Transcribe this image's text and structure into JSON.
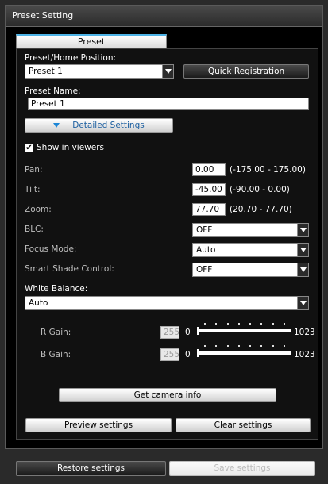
{
  "window": {
    "title": "Preset Setting"
  },
  "tab": {
    "label": "Preset"
  },
  "preset_home": {
    "label": "Preset/Home Position:",
    "selected": "Preset 1"
  },
  "quick_registration": {
    "label": "Quick Registration"
  },
  "preset_name": {
    "label": "Preset Name:",
    "value": "Preset 1"
  },
  "detailed_settings": {
    "label": "Detailed Settings"
  },
  "show_in_viewers": {
    "label": "Show in viewers",
    "checked": true,
    "mark": "✔"
  },
  "pan": {
    "label": "Pan:",
    "value": "0.00",
    "range": "(-175.00 - 175.00)"
  },
  "tilt": {
    "label": "Tilt:",
    "value": "-45.00",
    "range": "(-90.00 - 0.00)"
  },
  "zoom": {
    "label": "Zoom:",
    "value": "77.70",
    "range": "(20.70 - 77.70)"
  },
  "blc": {
    "label": "BLC:",
    "selected": "OFF"
  },
  "focus_mode": {
    "label": "Focus Mode:",
    "selected": "Auto"
  },
  "smart_shade": {
    "label": "Smart Shade Control:",
    "selected": "OFF"
  },
  "white_balance": {
    "label": "White Balance:",
    "selected": "Auto"
  },
  "r_gain": {
    "label": "R Gain:",
    "value": "255",
    "min": "0",
    "max": "1023"
  },
  "b_gain": {
    "label": "B Gain:",
    "value": "255",
    "min": "0",
    "max": "1023"
  },
  "get_camera_info": {
    "label": "Get camera info"
  },
  "preview_settings": {
    "label": "Preview settings"
  },
  "clear_settings": {
    "label": "Clear settings"
  },
  "restore_settings": {
    "label": "Restore settings"
  },
  "save_settings": {
    "label": "Save settings"
  },
  "colors": {
    "accent": "#1c86d6",
    "tab_top": "#4db3e6",
    "background": "#000000"
  }
}
